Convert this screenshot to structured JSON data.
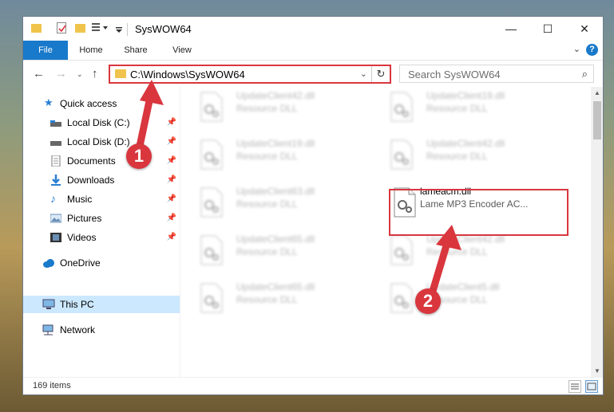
{
  "window": {
    "title": "SysWOW64",
    "minimize": "—",
    "maximize": "☐",
    "close": "✕"
  },
  "ribbon": {
    "tabs": [
      "File",
      "Home",
      "Share",
      "View"
    ],
    "help": "?"
  },
  "navigation": {
    "address_path": "C:\\Windows\\SysWOW64",
    "search_placeholder": "Search SysWOW64"
  },
  "sidebar": {
    "items": [
      {
        "label": "Quick access",
        "icon": "star-icon"
      },
      {
        "label": "Local Disk (C:)",
        "icon": "drive-icon",
        "pinned": true
      },
      {
        "label": "Local Disk (D:)",
        "icon": "drive-icon",
        "pinned": true
      },
      {
        "label": "Documents",
        "icon": "documents-icon",
        "pinned": true
      },
      {
        "label": "Downloads",
        "icon": "downloads-icon",
        "pinned": true
      },
      {
        "label": "Music",
        "icon": "music-icon",
        "pinned": true
      },
      {
        "label": "Pictures",
        "icon": "pictures-icon",
        "pinned": true
      },
      {
        "label": "Videos",
        "icon": "videos-icon",
        "pinned": true
      },
      {
        "label": "OneDrive",
        "icon": "cloud-icon"
      },
      {
        "label": "This PC",
        "icon": "computer-icon",
        "selected": true
      },
      {
        "label": "Network",
        "icon": "network-icon"
      }
    ]
  },
  "files": [
    {
      "name": "UpdateClient42.dll",
      "desc": "Resource DLL"
    },
    {
      "name": "UpdateClient19.dll",
      "desc": "Resource DLL"
    },
    {
      "name": "UpdateClient19.dll",
      "desc": "Resource DLL"
    },
    {
      "name": "UpdateClient42.dll",
      "desc": "Resource DLL"
    },
    {
      "name": "UpdateClient63.dll",
      "desc": "Resource DLL"
    },
    {
      "name": "lameacm.dll",
      "desc": "Lame MP3 Encoder AC..."
    },
    {
      "name": "UpdateClient65.dll",
      "desc": "Resource DLL"
    },
    {
      "name": "UpdateClient42.dll",
      "desc": "Resource DLL"
    },
    {
      "name": "UpdateClient65.dll",
      "desc": "Resource DLL"
    },
    {
      "name": "UpdateClient5.dll",
      "desc": "Resource DLL"
    }
  ],
  "status": {
    "item_count": "169 items"
  },
  "annotations": {
    "marker_1": "1",
    "marker_2": "2"
  },
  "colors": {
    "accent": "#1979ca",
    "highlight": "#d9363e",
    "selected_bg": "#cce8ff"
  }
}
